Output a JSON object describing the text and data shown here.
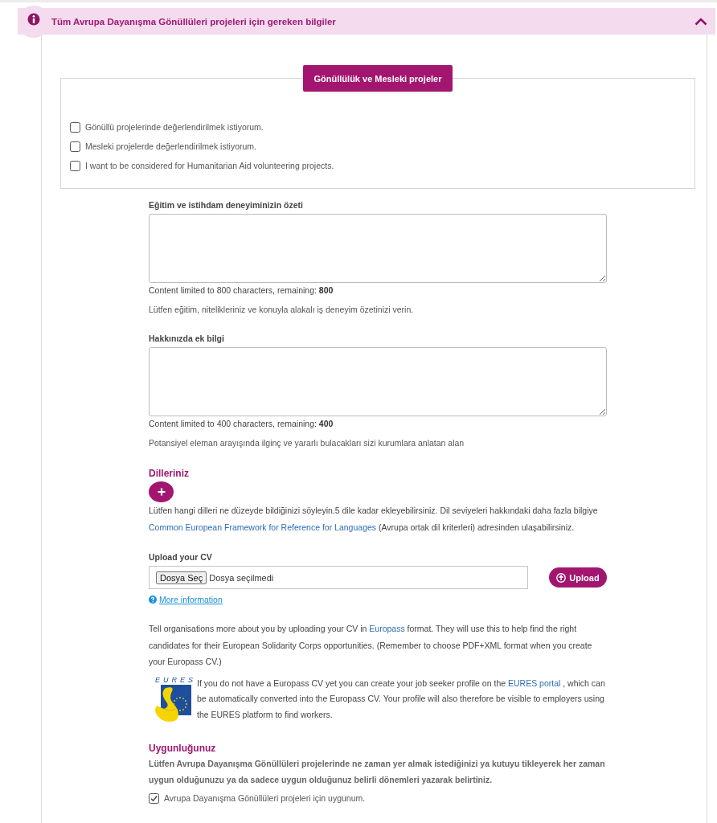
{
  "section": {
    "title": "Tüm Avrupa Dayanışma Gönüllüleri projeleri için gereken bilgiler",
    "expanded": true
  },
  "projects": {
    "legend": "Gönüllülük ve Mesleki projeler",
    "options": [
      {
        "label": "Gönüllü projelerinde değerlendirilmek istiyorum.",
        "checked": false
      },
      {
        "label": "Mesleki projelerde değerlendirilmek istiyorum.",
        "checked": false
      },
      {
        "label": "I want to be considered for Humanitarian Aid volunteering projects.",
        "checked": false
      }
    ]
  },
  "text_fields": [
    {
      "label": "Eğitim ve istihdam deneyiminizin özeti",
      "counter": "Content limited to 800 characters, remaining: **800**",
      "hint": "Lütfen eğitim, nitelikleriniz ve konuyla alakalı iş deneyim özetinizi verin."
    },
    {
      "label": "Hakkınızda ek bilgi",
      "counter": "Content limited to 400 characters, remaining: **400**",
      "hint": "Potansiyel eleman arayışında ilginç ve yararlı bulacakları sizi kurumlara anlatan alan"
    }
  ],
  "languages": {
    "heading": "Dilleriniz",
    "text_before": "Lütfen hangi dilleri ne düzeyde bildiğinizi söyleyin.5 dile kadar ekleyebilirsiniz. Dil seviyeleri hakkındaki daha fazla bilgiye",
    "link": "Common European Framework for Reference for Languages",
    "text_after": "(Avrupa ortak dil kriterleri) adresinden ulaşabilirsiniz."
  },
  "cv_upload": {
    "label": "Upload your CV",
    "choose_button": "Dosya Seç",
    "file_status": "Dosya seçilmedi",
    "upload_button": "Upload",
    "more_info_link": "More information",
    "text_before": "Tell organisations more about you by uploading your CV in",
    "link": "Europass",
    "text_after": "format. They will use this to help find the right candidates for their European Solidarity Corps opportunities. (Remember to choose PDF+XML format when you create your Europass CV.)"
  },
  "eures": {
    "logo_text": "EURES",
    "text_before": "If you do not have a Europass CV yet you can create your job seeker profile on the",
    "link": "EURES portal",
    "text_after": ", which can be automatically converted into the Europass CV. Your profile will also therefore be visible to employers using the EURES platform to find workers."
  },
  "availability": {
    "heading": "Uygunluğunuz",
    "text": "Lütfen Avrupa Dayanışma Gönüllüleri projelerinde ne zaman yer almak istediğinizi ya kutuyu tikleyerek her zaman uygun olduğunuzu ya da sadece uygun olduğunuz belirli dönemleri yazarak belirtiniz.",
    "option": {
      "label": "Avrupa Dayanışma Gönüllüleri projeleri için uygunum.",
      "checked": true
    }
  }
}
